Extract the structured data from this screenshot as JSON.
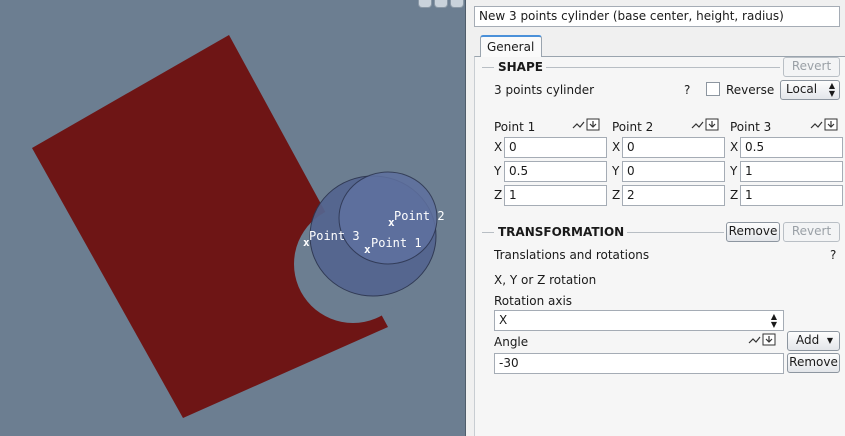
{
  "viewport": {
    "labels": {
      "point1": "Point 1",
      "point2": "Point 2",
      "point3": "Point 3"
    },
    "colors": {
      "background": "#6c7e91",
      "plane": "#6e1515",
      "cylinder": "#54658f"
    }
  },
  "panel": {
    "title": "New 3 points cylinder (base center, height, radius)",
    "tab": "General",
    "shape": {
      "title": "SHAPE",
      "revert": "Revert",
      "label": "3 points cylinder",
      "help": "?",
      "reverse": "Reverse",
      "frame": "Local",
      "points": [
        {
          "label": "Point 1",
          "x": "0",
          "y": "0.5",
          "z": "1"
        },
        {
          "label": "Point 2",
          "x": "0",
          "y": "0",
          "z": "2"
        },
        {
          "label": "Point 3",
          "x": "0.5",
          "y": "1",
          "z": "1"
        }
      ],
      "axes": {
        "x": "X",
        "y": "Y",
        "z": "Z"
      }
    },
    "transformation": {
      "title": "TRANSFORMATION",
      "remove": "Remove",
      "revert": "Revert",
      "translations": "Translations and rotations",
      "help": "?",
      "rotation_type": "X, Y or Z rotation",
      "axis_label": "Rotation axis",
      "axis_value": "X",
      "angle_label": "Angle",
      "add": "Add",
      "angle_value": "-30",
      "angle_remove": "Remove"
    }
  }
}
